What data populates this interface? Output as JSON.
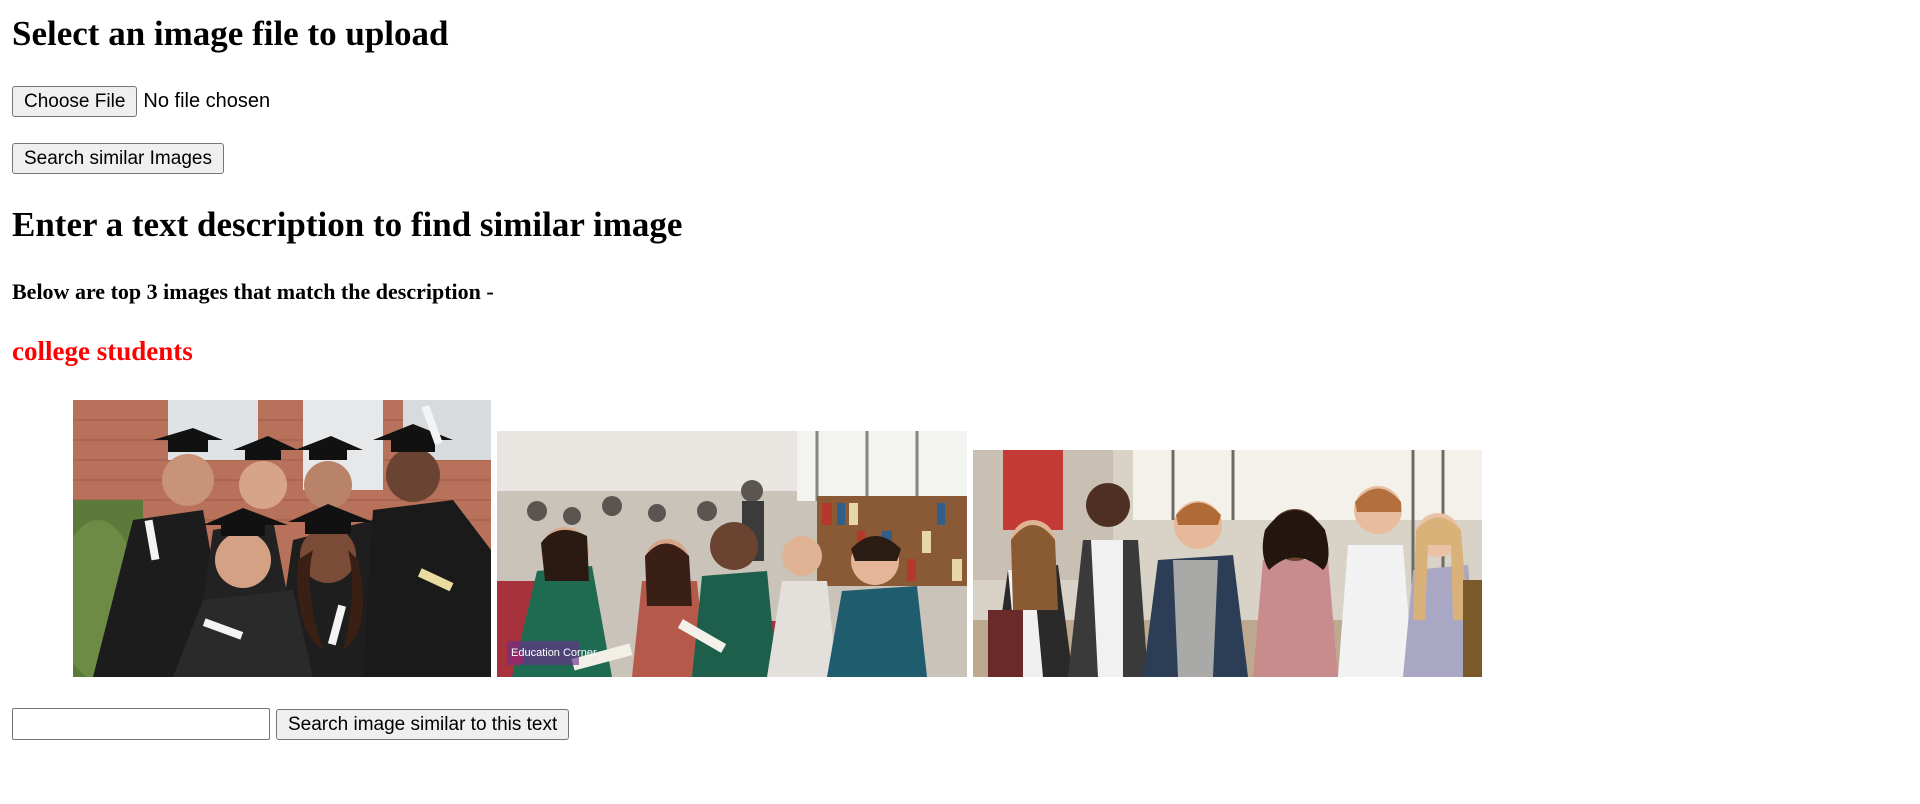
{
  "upload": {
    "heading": "Select an image file to upload",
    "choose_file_label": "Choose File",
    "file_status": "No file chosen",
    "search_similar_label": "Search similar Images"
  },
  "text_search": {
    "heading": "Enter a text description to find similar image",
    "results_heading": "Below are top 3 images that match the description -",
    "query": "college students",
    "query_color": "#ff0000",
    "input_value": "",
    "input_placeholder": "",
    "search_button_label": "Search image similar to this text"
  },
  "results": [
    {
      "subject": "graduates in caps and gowns holding diplomas"
    },
    {
      "subject": "students studying together in a library",
      "watermark": "Education Corner"
    },
    {
      "subject": "group of students talking in a hallway"
    }
  ]
}
